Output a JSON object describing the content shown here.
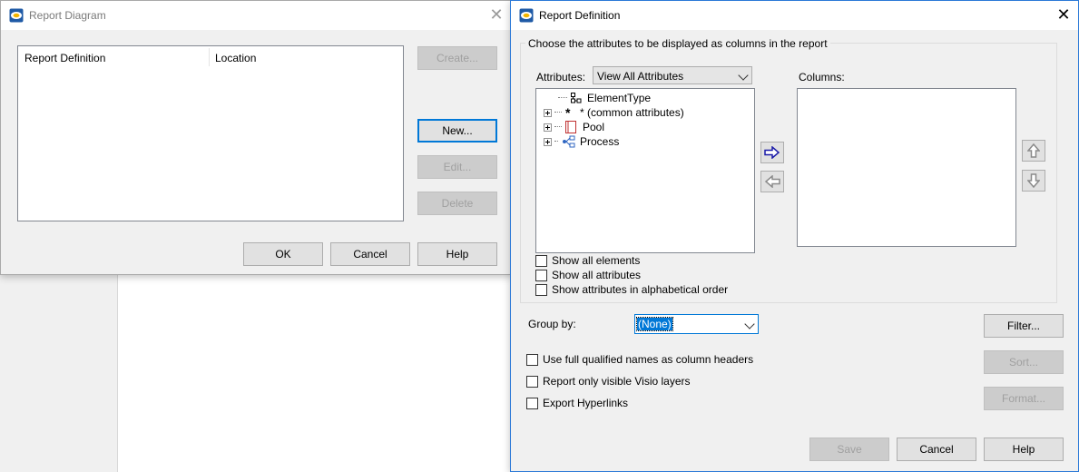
{
  "report_diagram": {
    "title": "Report Diagram",
    "table": {
      "columns": [
        "Report Definition",
        "Location"
      ]
    },
    "buttons": {
      "create": "Create...",
      "new": "New...",
      "edit": "Edit...",
      "delete": "Delete",
      "ok": "OK",
      "cancel": "Cancel",
      "help": "Help"
    }
  },
  "report_definition": {
    "title": "Report Definition",
    "group_legend": "Choose the attributes to be displayed as columns in the report",
    "attributes_label": "Attributes:",
    "attributes_select": "View All Attributes",
    "columns_label": "Columns:",
    "tree": [
      {
        "label": "ElementType",
        "icon": "element-type-icon"
      },
      {
        "label": "* (common attributes)",
        "icon": "asterisk-icon"
      },
      {
        "label": "Pool",
        "icon": "pool-icon"
      },
      {
        "label": "Process",
        "icon": "process-icon"
      }
    ],
    "checkboxes": [
      "Show all elements",
      "Show all attributes",
      "Show attributes in alphabetical order"
    ],
    "group_by_label": "Group by:",
    "group_by_value": "(None)",
    "options": [
      "Use full qualified names as column headers",
      "Report only visible Visio layers",
      "Export Hyperlinks"
    ],
    "buttons": {
      "filter": "Filter...",
      "sort": "Sort...",
      "format": "Format...",
      "save": "Save",
      "cancel": "Cancel",
      "help": "Help"
    },
    "colors": {
      "accent": "#0078d7",
      "arrow": "#1a1aa8"
    }
  }
}
